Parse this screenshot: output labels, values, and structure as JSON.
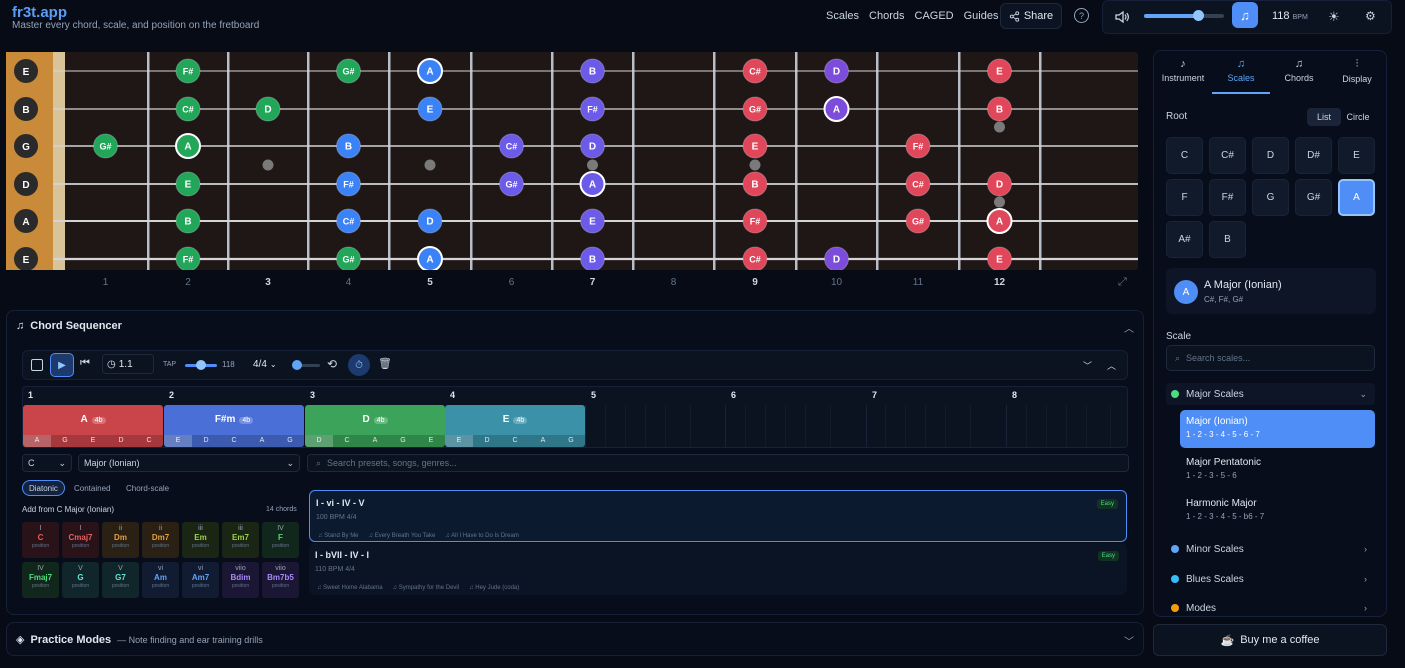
{
  "header": {
    "brand": "fr3t.app",
    "tagline": "Master every chord, scale, and position on the fretboard",
    "nav": [
      "Scales",
      "Chords",
      "CAGED",
      "Guides"
    ],
    "share_label": "Share",
    "bpm": "118",
    "bpm_unit": "BPM",
    "volume": 0.7
  },
  "fretboard": {
    "strings": [
      "E",
      "B",
      "G",
      "D",
      "A",
      "E"
    ],
    "fret_numbers": [
      "1",
      "2",
      "3",
      "4",
      "5",
      "6",
      "7",
      "8",
      "9",
      "10",
      "11",
      "12"
    ],
    "inlays": [
      3,
      5,
      7,
      9,
      12
    ],
    "notes": [
      {
        "s": 0,
        "f": 2,
        "n": "F#",
        "c": "#22a659"
      },
      {
        "s": 0,
        "f": 4,
        "n": "G#",
        "c": "#22a659"
      },
      {
        "s": 0,
        "f": 5,
        "n": "A",
        "c": "#3b82f6",
        "root": true
      },
      {
        "s": 0,
        "f": 7,
        "n": "B",
        "c": "#6b5be8"
      },
      {
        "s": 0,
        "f": 9,
        "n": "C#",
        "c": "#e0475a"
      },
      {
        "s": 0,
        "f": 10,
        "n": "D",
        "c": "#7c4ddb"
      },
      {
        "s": 0,
        "f": 12,
        "n": "E",
        "c": "#e0475a"
      },
      {
        "s": 1,
        "f": 2,
        "n": "C#",
        "c": "#22a659"
      },
      {
        "s": 1,
        "f": 3,
        "n": "D",
        "c": "#22a659"
      },
      {
        "s": 1,
        "f": 5,
        "n": "E",
        "c": "#3b82f6"
      },
      {
        "s": 1,
        "f": 7,
        "n": "F#",
        "c": "#6b5be8"
      },
      {
        "s": 1,
        "f": 9,
        "n": "G#",
        "c": "#e0475a"
      },
      {
        "s": 1,
        "f": 10,
        "n": "A",
        "c": "#7c4ddb",
        "root": true
      },
      {
        "s": 1,
        "f": 12,
        "n": "B",
        "c": "#e0475a"
      },
      {
        "s": 2,
        "f": 1,
        "n": "G#",
        "c": "#22a659"
      },
      {
        "s": 2,
        "f": 2,
        "n": "A",
        "c": "#22a659",
        "root": true
      },
      {
        "s": 2,
        "f": 4,
        "n": "B",
        "c": "#3b82f6"
      },
      {
        "s": 2,
        "f": 6,
        "n": "C#",
        "c": "#6b5be8"
      },
      {
        "s": 2,
        "f": 7,
        "n": "D",
        "c": "#6b5be8"
      },
      {
        "s": 2,
        "f": 9,
        "n": "E",
        "c": "#e0475a"
      },
      {
        "s": 2,
        "f": 11,
        "n": "F#",
        "c": "#e0475a"
      },
      {
        "s": 3,
        "f": 2,
        "n": "E",
        "c": "#22a659"
      },
      {
        "s": 3,
        "f": 4,
        "n": "F#",
        "c": "#3b82f6"
      },
      {
        "s": 3,
        "f": 6,
        "n": "G#",
        "c": "#6b5be8"
      },
      {
        "s": 3,
        "f": 7,
        "n": "A",
        "c": "#6b5be8",
        "root": true
      },
      {
        "s": 3,
        "f": 9,
        "n": "B",
        "c": "#e0475a"
      },
      {
        "s": 3,
        "f": 11,
        "n": "C#",
        "c": "#e0475a"
      },
      {
        "s": 3,
        "f": 12,
        "n": "D",
        "c": "#e0475a"
      },
      {
        "s": 4,
        "f": 2,
        "n": "B",
        "c": "#22a659"
      },
      {
        "s": 4,
        "f": 4,
        "n": "C#",
        "c": "#3b82f6"
      },
      {
        "s": 4,
        "f": 5,
        "n": "D",
        "c": "#3b82f6"
      },
      {
        "s": 4,
        "f": 7,
        "n": "E",
        "c": "#6b5be8"
      },
      {
        "s": 4,
        "f": 9,
        "n": "F#",
        "c": "#e0475a"
      },
      {
        "s": 4,
        "f": 11,
        "n": "G#",
        "c": "#e0475a"
      },
      {
        "s": 4,
        "f": 12,
        "n": "A",
        "c": "#e0475a",
        "root": true
      },
      {
        "s": 5,
        "f": 2,
        "n": "F#",
        "c": "#22a659"
      },
      {
        "s": 5,
        "f": 4,
        "n": "G#",
        "c": "#22a659"
      },
      {
        "s": 5,
        "f": 5,
        "n": "A",
        "c": "#3b82f6",
        "root": true
      },
      {
        "s": 5,
        "f": 7,
        "n": "B",
        "c": "#6b5be8"
      },
      {
        "s": 5,
        "f": 9,
        "n": "C#",
        "c": "#e0475a"
      },
      {
        "s": 5,
        "f": 10,
        "n": "D",
        "c": "#7c4ddb"
      },
      {
        "s": 5,
        "f": 12,
        "n": "E",
        "c": "#e0475a"
      }
    ]
  },
  "sequencer": {
    "title": "Chord Sequencer",
    "position": "1.1",
    "tap_label": "TAP",
    "tempo": "118",
    "meter": "4/4",
    "bars": [
      "1",
      "2",
      "3",
      "4",
      "5",
      "6",
      "7",
      "8"
    ],
    "chords": [
      {
        "name": "A",
        "beats": "4b",
        "color": "#c9454a",
        "notes": [
          "A",
          "G",
          "E",
          "D",
          "C"
        ]
      },
      {
        "name": "F#m",
        "beats": "4b",
        "color": "#4a6fd6",
        "notes": [
          "E",
          "D",
          "C",
          "A",
          "G"
        ]
      },
      {
        "name": "D",
        "beats": "4b",
        "color": "#3ba45a",
        "notes": [
          "D",
          "C",
          "A",
          "G",
          "E"
        ]
      },
      {
        "name": "E",
        "beats": "4b",
        "color": "#3a91a8",
        "notes": [
          "E",
          "D",
          "C",
          "A",
          "G"
        ]
      }
    ],
    "key": "C",
    "scale": "Major (Ionian)",
    "preset_placeholder": "Search presets, songs, genres...",
    "modes": [
      "Diatonic",
      "Contained",
      "Chord-scale"
    ],
    "add_from": "Add from C Major (Ionian)",
    "chord_count": "14 chords",
    "palette": [
      {
        "deg": "I",
        "name": "C",
        "color": "#e56161",
        "bg": "#2a1318"
      },
      {
        "deg": "I",
        "name": "Cmaj7",
        "color": "#e56161",
        "bg": "#2a1318"
      },
      {
        "deg": "ii",
        "name": "Dm",
        "color": "#e6a23c",
        "bg": "#2a2014"
      },
      {
        "deg": "ii",
        "name": "Dm7",
        "color": "#e6a23c",
        "bg": "#2a2014"
      },
      {
        "deg": "iii",
        "name": "Em",
        "color": "#9bd34a",
        "bg": "#1a2514"
      },
      {
        "deg": "iii",
        "name": "Em7",
        "color": "#9bd34a",
        "bg": "#1a2514"
      },
      {
        "deg": "IV",
        "name": "F",
        "color": "#4ade80",
        "bg": "#12271b"
      },
      {
        "deg": "IV",
        "name": "Fmaj7",
        "color": "#4ade80",
        "bg": "#12271b"
      },
      {
        "deg": "V",
        "name": "G",
        "color": "#5eead4",
        "bg": "#10262a"
      },
      {
        "deg": "V",
        "name": "G7",
        "color": "#5eead4",
        "bg": "#10262a"
      },
      {
        "deg": "vi",
        "name": "Am",
        "color": "#60a5fa",
        "bg": "#111c33"
      },
      {
        "deg": "vi",
        "name": "Am7",
        "color": "#60a5fa",
        "bg": "#111c33"
      },
      {
        "deg": "viio",
        "name": "Bdim",
        "color": "#a78bfa",
        "bg": "#1a1633"
      },
      {
        "deg": "viio",
        "name": "Bm7b5",
        "color": "#a78bfa",
        "bg": "#1a1633"
      }
    ],
    "palette_sub": "position",
    "presets": [
      {
        "title": "I - vi - IV - V",
        "meta": "100 BPM  4/4",
        "badge": "Easy",
        "songs": [
          "Stand By Me",
          "Every Breath You Take",
          "All I Have to Do Is Dream"
        ]
      },
      {
        "title": "I - bVII - IV - I",
        "meta": "110 BPM  4/4",
        "badge": "Easy",
        "songs": [
          "Sweet Home Alabama",
          "Sympathy for the Devil",
          "Hey Jude (coda)"
        ]
      }
    ]
  },
  "practice": {
    "title": "Practice Modes",
    "desc": "— Note finding and ear training drills"
  },
  "panel": {
    "tabs": [
      "Instrument",
      "Scales",
      "Chords",
      "Display"
    ],
    "root_label": "Root",
    "view": [
      "List",
      "Circle"
    ],
    "roots": [
      "C",
      "C#",
      "D",
      "D#",
      "E",
      "F",
      "F#",
      "G",
      "G#",
      "A",
      "A#",
      "B"
    ],
    "key_badge": "A",
    "key_name": "A Major (Ionian)",
    "key_notes": "C#, F#, G#",
    "scale_label": "Scale",
    "scale_placeholder": "Search scales...",
    "categories": [
      {
        "name": "Major Scales",
        "color": "#4ade80"
      },
      {
        "name": "Minor Scales",
        "color": "#60a5fa"
      },
      {
        "name": "Blues Scales",
        "color": "#38bdf8"
      },
      {
        "name": "Modes",
        "color": "#f59e0b"
      }
    ],
    "scales": [
      {
        "name": "Major (Ionian)",
        "formula": "1 - 2 - 3 - 4 - 5 - 6 - 7"
      },
      {
        "name": "Major Pentatonic",
        "formula": "1 - 2 - 3 - 5 - 6"
      },
      {
        "name": "Harmonic Major",
        "formula": "1 - 2 - 3 - 4 - 5 - b6 - 7"
      }
    ],
    "coffee": "Buy me a coffee"
  }
}
